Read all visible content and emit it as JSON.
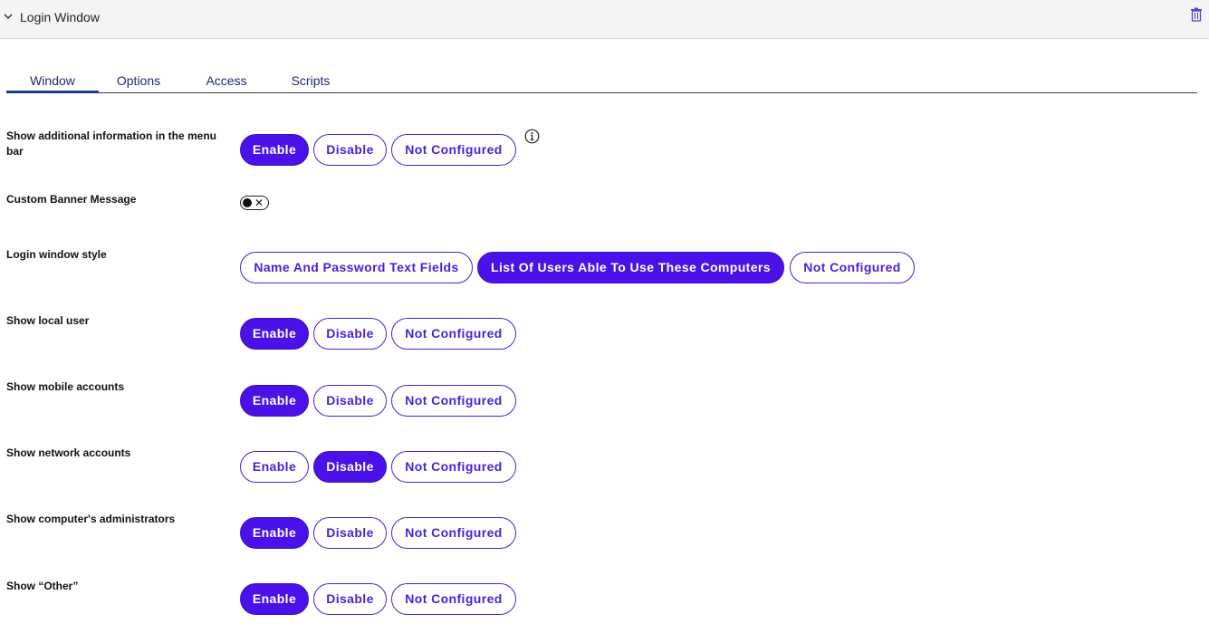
{
  "header": {
    "title": "Login Window"
  },
  "tabs": [
    {
      "label": "Window",
      "active": true
    },
    {
      "label": "Options",
      "active": false
    },
    {
      "label": "Access",
      "active": false
    },
    {
      "label": "Scripts",
      "active": false
    }
  ],
  "rows": {
    "menu_bar_info": {
      "label": "Show additional information in the menu bar",
      "options": [
        "Enable",
        "Disable",
        "Not Configured"
      ],
      "selected": "Enable"
    },
    "banner": {
      "label": "Custom Banner Message",
      "toggle_on": false
    },
    "login_style": {
      "label": "Login window style",
      "options": [
        "Name And Password Text Fields",
        "List Of Users Able To Use These Computers",
        "Not Configured"
      ],
      "selected": "List Of Users Able To Use These Computers"
    },
    "local_user": {
      "label": "Show local user",
      "options": [
        "Enable",
        "Disable",
        "Not Configured"
      ],
      "selected": "Enable"
    },
    "mobile_accounts": {
      "label": "Show mobile accounts",
      "options": [
        "Enable",
        "Disable",
        "Not Configured"
      ],
      "selected": "Enable"
    },
    "network_accounts": {
      "label": "Show network accounts",
      "options": [
        "Enable",
        "Disable",
        "Not Configured"
      ],
      "selected": "Disable"
    },
    "administrators": {
      "label": "Show computer's administrators",
      "options": [
        "Enable",
        "Disable",
        "Not Configured"
      ],
      "selected": "Enable"
    },
    "other": {
      "label": "Show “Other”",
      "options": [
        "Enable",
        "Disable",
        "Not Configured"
      ],
      "selected": "Enable"
    }
  },
  "colors": {
    "accent": "#4a12e8",
    "tab_text": "#1f2a6b"
  },
  "icons": {
    "collapse": "chevron-down-icon",
    "delete": "trash-icon",
    "info": "info-icon"
  }
}
